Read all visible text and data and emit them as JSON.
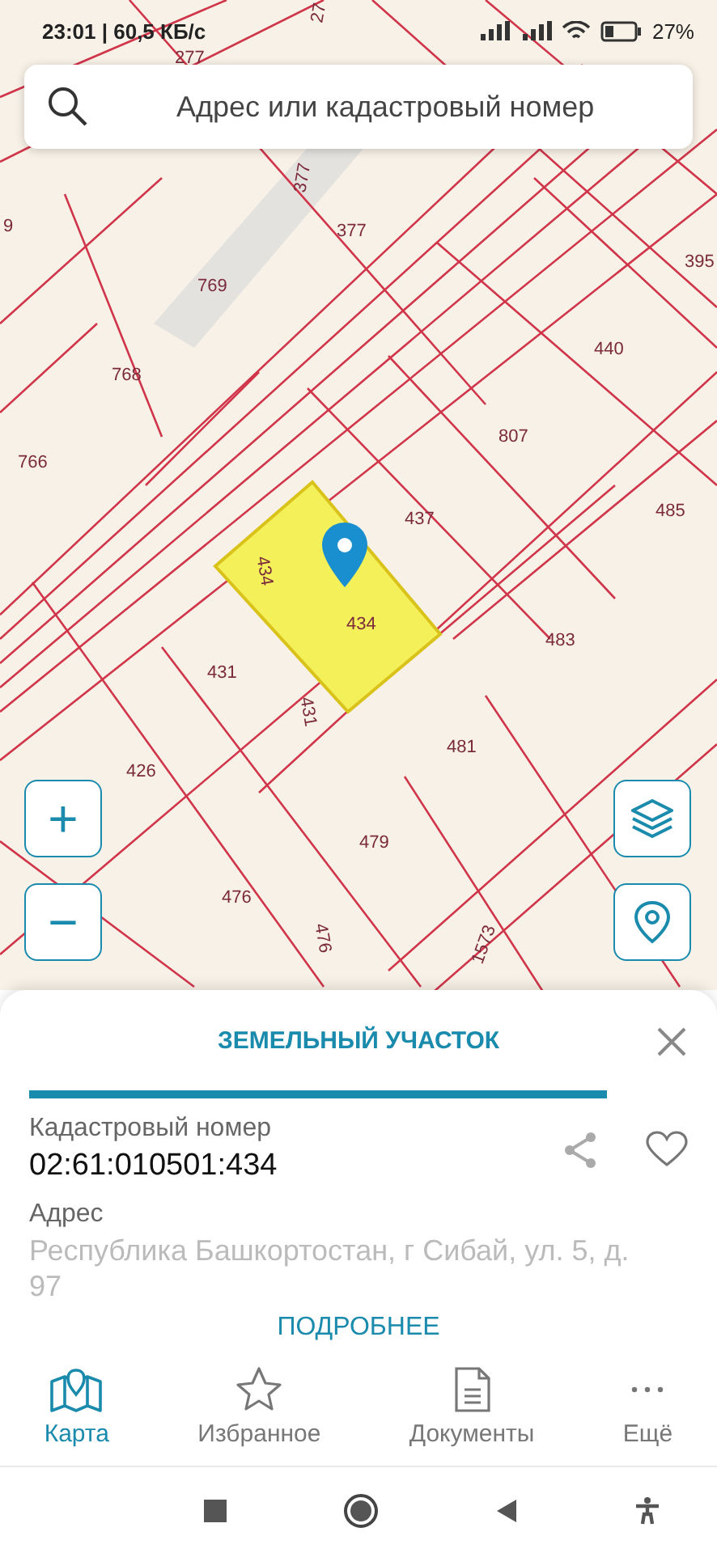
{
  "status_bar": {
    "time": "23:01 | 60,5 КБ/с",
    "battery": "27%"
  },
  "search": {
    "placeholder": "Адрес или кадастровый номер"
  },
  "map": {
    "parcels": [
      {
        "label": "27"
      },
      {
        "label": "277"
      },
      {
        "label": "377"
      },
      {
        "label": "377"
      },
      {
        "label": "395"
      },
      {
        "label": "769"
      },
      {
        "label": "9"
      },
      {
        "label": "768"
      },
      {
        "label": "440"
      },
      {
        "label": "766"
      },
      {
        "label": "807"
      },
      {
        "label": "437"
      },
      {
        "label": "485"
      },
      {
        "label": "434"
      },
      {
        "label": "434"
      },
      {
        "label": "483"
      },
      {
        "label": "431"
      },
      {
        "label": "431"
      },
      {
        "label": "481"
      },
      {
        "label": "426"
      },
      {
        "label": "479"
      },
      {
        "label": "476"
      },
      {
        "label": "476"
      },
      {
        "label": "1573"
      }
    ],
    "zoom_in": "+",
    "zoom_out": "−"
  },
  "sheet": {
    "title": "ЗЕМЕЛЬНЫЙ УЧАСТОК",
    "fields": [
      {
        "label": "Кадастровый номер",
        "value": "02:61:010501:434"
      },
      {
        "label": "Адрес",
        "value": "Республика Башкортостан, г Сибай, ул. 5, д. 97"
      }
    ],
    "more": "ПОДРОБНЕЕ"
  },
  "tabs": [
    {
      "label": "Карта",
      "selected": true
    },
    {
      "label": "Избранное",
      "selected": false
    },
    {
      "label": "Документы",
      "selected": false
    },
    {
      "label": "Ещё",
      "selected": false
    }
  ]
}
